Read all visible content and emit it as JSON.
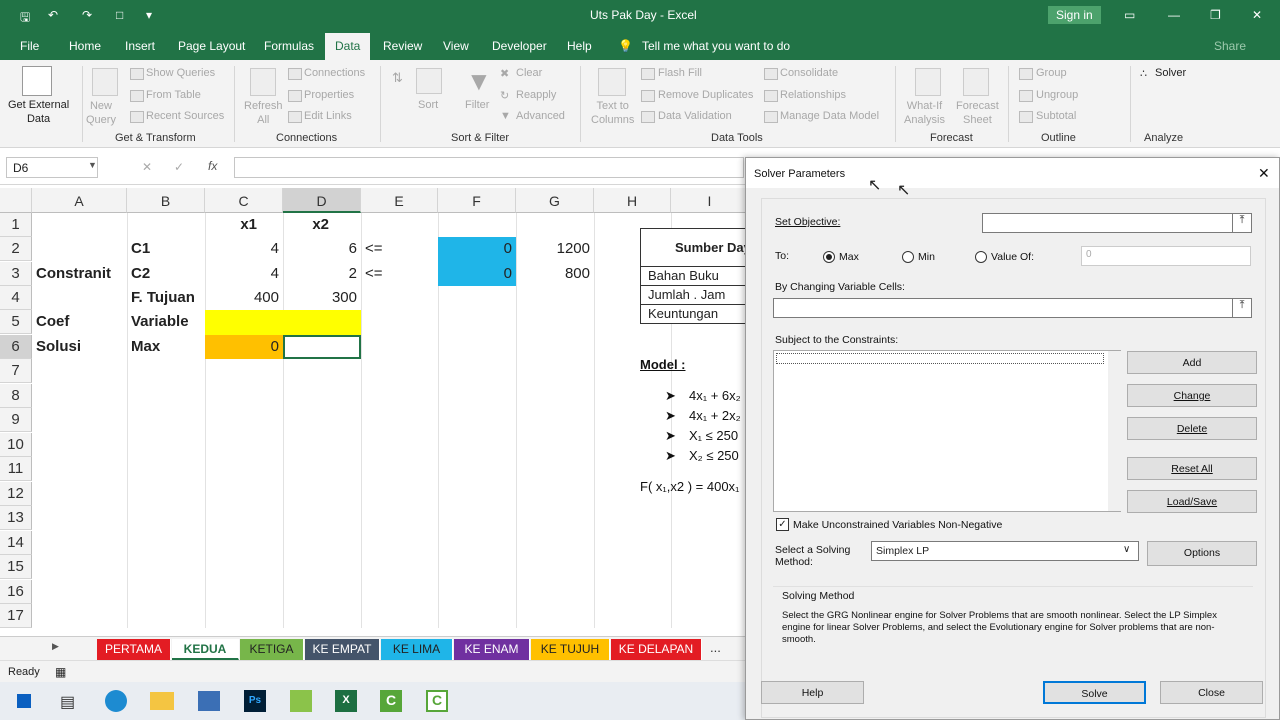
{
  "app": {
    "title": "Uts Pak Day - Excel",
    "signin": "Sign in",
    "share": "Share"
  },
  "menu": [
    "File",
    "Home",
    "Insert",
    "Page Layout",
    "Formulas",
    "Data",
    "Review",
    "View",
    "Developer",
    "Help"
  ],
  "tell_me": "Tell me what you want to do",
  "ribbon": {
    "get_external": "Get External\nData",
    "new_query": "New\nQuery",
    "show_queries": "Show Queries",
    "from_table": "From Table",
    "recent_sources": "Recent Sources",
    "refresh_all": "Refresh\nAll",
    "connections": "Connections",
    "properties": "Properties",
    "edit_links": "Edit Links",
    "sort": "Sort",
    "filter": "Filter",
    "clear": "Clear",
    "reapply": "Reapply",
    "advanced": "Advanced",
    "text_to_columns": "Text to\nColumns",
    "flash_fill": "Flash Fill",
    "remove_duplicates": "Remove Duplicates",
    "data_validation": "Data Validation",
    "consolidate": "Consolidate",
    "relationships": "Relationships",
    "manage_data_model": "Manage Data Model",
    "whatif": "What-If\nAnalysis",
    "forecast_sheet": "Forecast\nSheet",
    "group": "Group",
    "ungroup": "Ungroup",
    "subtotal": "Subtotal",
    "solver": "Solver",
    "groups": [
      "Get & Transform",
      "Connections",
      "Sort & Filter",
      "Data Tools",
      "Forecast",
      "Outline",
      "Analyze"
    ]
  },
  "namebox": "D6",
  "fx": "fx",
  "columns": [
    "A",
    "B",
    "C",
    "D",
    "E",
    "F",
    "G",
    "H",
    "I"
  ],
  "rows": [
    "1",
    "2",
    "3",
    "4",
    "5",
    "6",
    "7",
    "8",
    "9",
    "10",
    "11",
    "12",
    "13",
    "14",
    "15",
    "16",
    "17"
  ],
  "cells": {
    "C1": "x1",
    "D1": "x2",
    "B2": "C1",
    "C2": "4",
    "D2": "6",
    "E2": "<=",
    "F2": "0",
    "G2": "1200",
    "A3": "Constranit",
    "B3": "C2",
    "C3": "4",
    "D3": "2",
    "E3": "<=",
    "F3": "0",
    "G3": "800",
    "B4": "F. Tujuan",
    "C4": "400",
    "D4": "300",
    "A5": "Coef",
    "B5": "Variable",
    "A6": "Solusi",
    "B6": "Max",
    "C6": "0"
  },
  "picture": {
    "header": "Sumber Day",
    "rows": [
      "Bahan Buku",
      "Jumlah . Jam",
      "Keuntungan"
    ],
    "model": "Model :",
    "c1": "4x₁ + 6x₂",
    "c2": "4x₁ + 2x₂",
    "c3": "X₁ ≤ 250",
    "c4": "X₂ ≤ 250",
    "fx": "F( x₁,x2 ) = 400x₁"
  },
  "tabs": [
    {
      "label": "PERTAMA",
      "color": "#e31c23"
    },
    {
      "label": "KEDUA",
      "color": "#ffffff"
    },
    {
      "label": "KETIGA",
      "color": "#77b64a"
    },
    {
      "label": "KE EMPAT",
      "color": "#44546a"
    },
    {
      "label": "KE LIMA",
      "color": "#1fb5e8"
    },
    {
      "label": "KE ENAM",
      "color": "#7030a0"
    },
    {
      "label": "KE TUJUH",
      "color": "#ffc000"
    },
    {
      "label": "KE DELAPAN",
      "color": "#e31c23"
    }
  ],
  "tabs_more": "...",
  "status": "Ready",
  "dialog": {
    "title": "Solver Parameters",
    "set_objective": "Set Objective:",
    "to": "To:",
    "max": "Max",
    "min": "Min",
    "value_of": "Value Of:",
    "value": "0",
    "changing": "By Changing Variable Cells:",
    "subject": "Subject to the Constraints:",
    "add": "Add",
    "change": "Change",
    "delete": "Delete",
    "reset": "Reset All",
    "load": "Load/Save",
    "nonneg": "Make Unconstrained Variables Non-Negative",
    "select_method": "Select a Solving\nMethod:",
    "method": "Simplex LP",
    "options": "Options",
    "solving_method": "Solving Method",
    "desc": "Select the GRG Nonlinear engine for Solver Problems that are smooth nonlinear. Select the LP Simplex engine for linear Solver Problems, and select the Evolutionary engine for Solver problems that are non-smooth.",
    "help": "Help",
    "solve": "Solve",
    "close": "Close"
  },
  "colors": {
    "excel_green": "#217346",
    "blue_fill": "#1fb5e8",
    "yellow": "#ffff00",
    "orange": "#ffc000"
  }
}
